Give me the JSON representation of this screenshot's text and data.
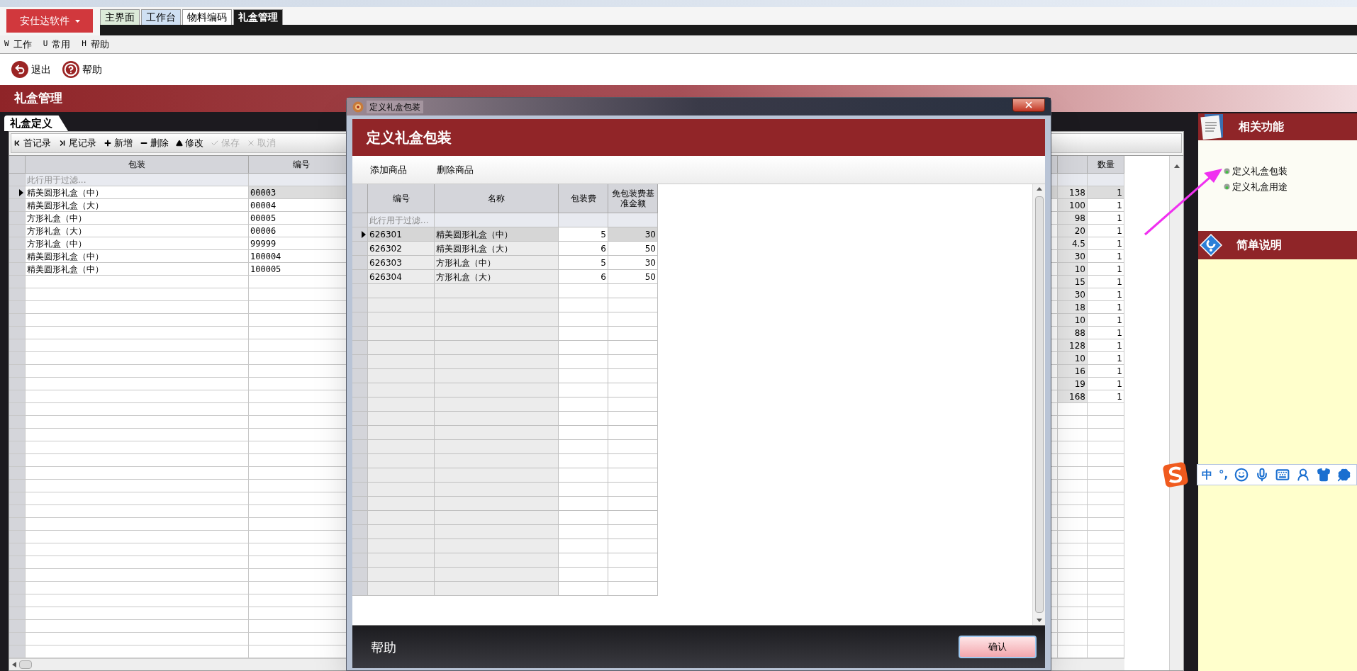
{
  "brand_button": {
    "label": "安仕达软件"
  },
  "module_tabs": [
    {
      "label": "主界面",
      "selected": false,
      "color": "#dcebd9"
    },
    {
      "label": "工作台",
      "selected": false,
      "color": "#cfe0f3"
    },
    {
      "label": "物料编码",
      "selected": false,
      "color": "#ffffff"
    },
    {
      "label": "礼盒管理",
      "selected": true,
      "color": "#1a1a1a"
    }
  ],
  "menu": [
    {
      "key": "W",
      "label": "工作"
    },
    {
      "key": "U",
      "label": "常用"
    },
    {
      "key": "H",
      "label": "帮助"
    }
  ],
  "toolbar": [
    {
      "kind": "exit",
      "label": "退出"
    },
    {
      "kind": "help",
      "label": "帮助"
    }
  ],
  "banner": {
    "title": "礼盒管理"
  },
  "page_tab": {
    "label": "礼盒定义"
  },
  "grid_toolbar": [
    {
      "kind": "first",
      "label": "首记录",
      "disabled": false
    },
    {
      "kind": "last",
      "label": "尾记录",
      "disabled": false
    },
    {
      "kind": "add",
      "label": "新增",
      "disabled": false
    },
    {
      "kind": "delete",
      "label": "删除",
      "disabled": false
    },
    {
      "kind": "edit",
      "label": "修改",
      "disabled": false
    },
    {
      "kind": "save",
      "label": "保存",
      "disabled": true
    },
    {
      "kind": "cancel",
      "label": "取消",
      "disabled": true
    }
  ],
  "main_grid": {
    "columns": {
      "package": "包装",
      "code": "编号",
      "quantity": "数量"
    },
    "filter_placeholder": "此行用于过滤...",
    "rows": [
      {
        "package": "精美圆形礼盒（中）",
        "code": "00003",
        "column_3": "138",
        "quantity": "1",
        "selected": true
      },
      {
        "package": "精美圆形礼盒（大）",
        "code": "00004",
        "column_3": "100",
        "quantity": "1",
        "selected": false
      },
      {
        "package": "方形礼盒（中）",
        "code": "00005",
        "column_3": "98",
        "quantity": "1",
        "selected": false
      },
      {
        "package": "方形礼盒（大）",
        "code": "00006",
        "column_3": "20",
        "quantity": "1",
        "selected": false
      },
      {
        "package": "方形礼盒（中）",
        "code": "99999",
        "column_3": "4.5",
        "quantity": "1",
        "selected": false
      },
      {
        "package": "精美圆形礼盒（中）",
        "code": "100004",
        "column_3": "30",
        "quantity": "1",
        "selected": false
      },
      {
        "package": "精美圆形礼盒（中）",
        "code": "100005",
        "column_3": "10",
        "quantity": "1",
        "selected": false
      },
      {
        "column_3": "15",
        "quantity": "1",
        "selected": false
      },
      {
        "column_3": "30",
        "quantity": "1",
        "selected": false
      },
      {
        "column_3": "18",
        "quantity": "1",
        "selected": false
      },
      {
        "column_3": "10",
        "quantity": "1",
        "selected": false
      },
      {
        "column_3": "88",
        "quantity": "1",
        "selected": false
      },
      {
        "column_3": "128",
        "quantity": "1",
        "selected": false
      },
      {
        "column_3": "10",
        "quantity": "1",
        "selected": false
      },
      {
        "column_3": "16",
        "quantity": "1",
        "selected": false
      },
      {
        "column_3": "19",
        "quantity": "1",
        "selected": false
      },
      {
        "column_3": "168",
        "quantity": "1",
        "selected": false
      }
    ]
  },
  "side_panel": {
    "related": {
      "title": "相关功能",
      "links": [
        "定义礼盒包装",
        "定义礼盒用途"
      ]
    },
    "notes": {
      "title": "简单说明"
    }
  },
  "dialog": {
    "window_title": "定义礼盒包装",
    "header": "定义礼盒包装",
    "actions": [
      "添加商品",
      "删除商品"
    ],
    "columns": {
      "code": "编号",
      "name": "名称",
      "fee": "包装费",
      "threshold": "免包装费基准金额"
    },
    "filter_placeholder": "此行用于过滤...",
    "rows": [
      {
        "code": "626301",
        "name": "精美圆形礼盒（中）",
        "fee": "5",
        "threshold": "30",
        "selected": true
      },
      {
        "code": "626302",
        "name": "精美圆形礼盒（大）",
        "fee": "6",
        "threshold": "50",
        "selected": false
      },
      {
        "code": "626303",
        "name": "方形礼盒（中）",
        "fee": "5",
        "threshold": "30",
        "selected": false
      },
      {
        "code": "626304",
        "name": "方形礼盒（大）",
        "fee": "6",
        "threshold": "50",
        "selected": false
      }
    ],
    "footer_help": "帮助",
    "confirm_button": "确认"
  },
  "ime_toolbar": {
    "mode": "中",
    "punctuation": "°,"
  }
}
